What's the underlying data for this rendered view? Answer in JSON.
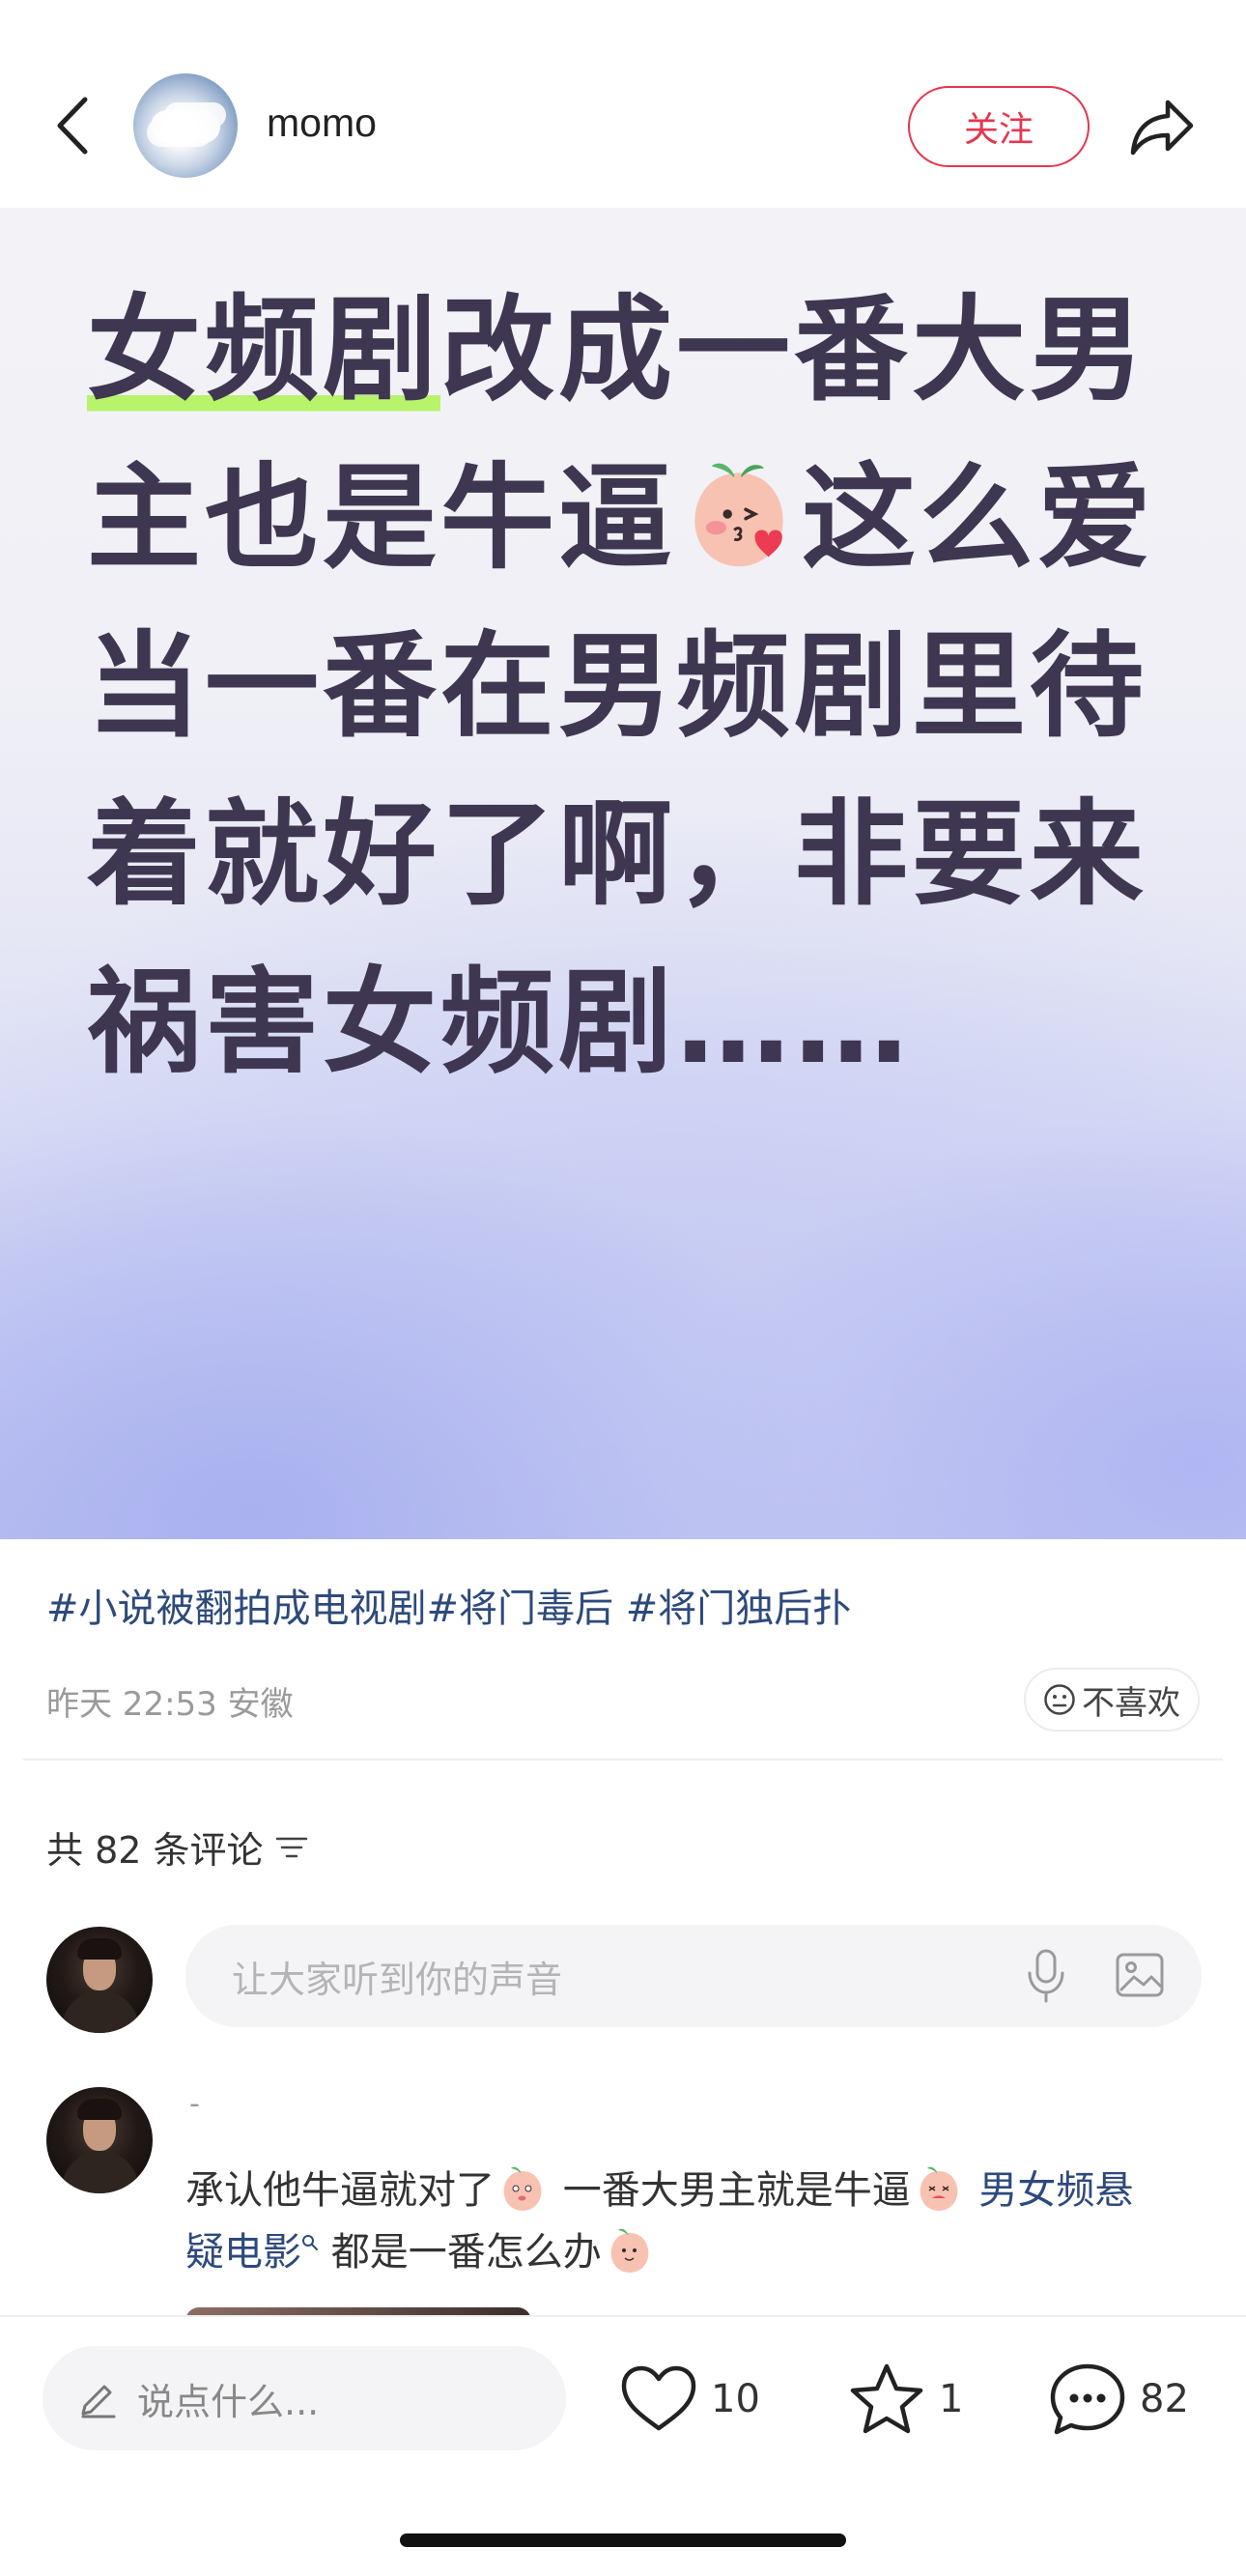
{
  "header": {
    "username": "momo",
    "follow_label": "关注"
  },
  "post": {
    "hero_lines": {
      "l1_highlight": "女频剧",
      "l1_rest": "改成一番大男",
      "l2_a": "主也是牛逼",
      "l2_b": "这么爱",
      "l3": "当一番在男频剧里待",
      "l4": "着就好了啊，非要来",
      "l5": "祸害女频剧……"
    },
    "tags": "#小说被翻拍成电视剧#将门毒后 #将门独后扑",
    "meta": "昨天 22:53 安徽",
    "dislike_label": "不喜欢"
  },
  "comments": {
    "count_text": "共 82 条评论",
    "input_placeholder": "让大家听到你的声音",
    "items": [
      {
        "name": "-",
        "line1_a": "承认他牛逼就对了",
        "line1_b": " 一番大男主就是牛逼",
        "line1_link": " 男女频悬",
        "line2_link": "疑电影",
        "line2_b": " 都是一番怎么办"
      }
    ]
  },
  "bottom_bar": {
    "say_placeholder": "说点什么...",
    "likes": "10",
    "stars": "1",
    "comments": "82"
  },
  "colors": {
    "accent_red": "#e5364d",
    "link_blue": "#2e4a7c",
    "hero_text": "#3f3751",
    "highlight_green": "#b7f36b"
  },
  "icons": [
    "back-icon",
    "share-icon",
    "peach-emoji-icon",
    "neutral-face-icon",
    "filter-icon",
    "mic-icon",
    "image-icon",
    "search-tag-icon",
    "pencil-icon",
    "heart-icon",
    "star-icon",
    "chat-icon"
  ]
}
